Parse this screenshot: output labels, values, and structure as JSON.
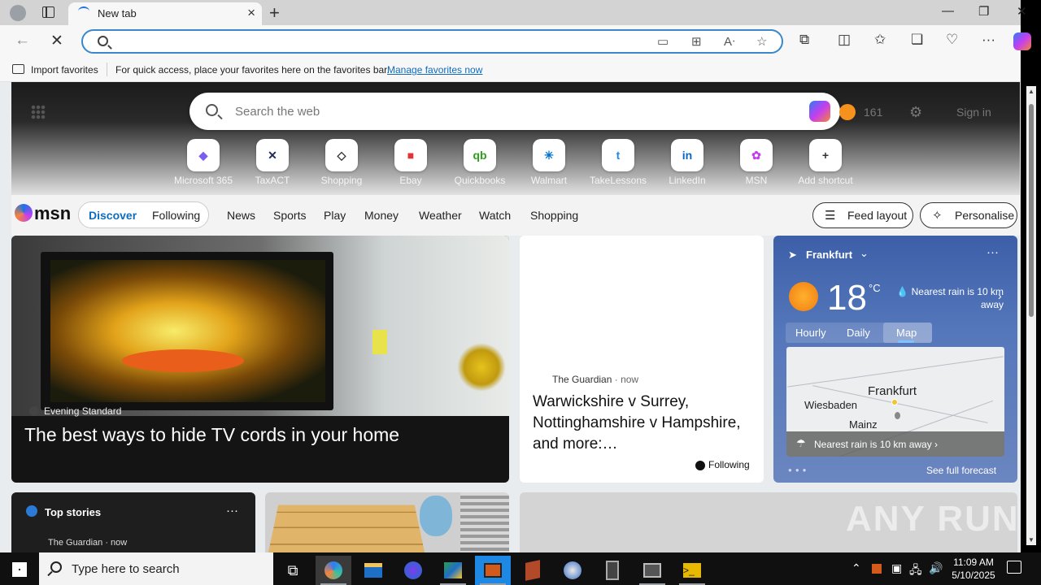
{
  "browser": {
    "tab_title": "New tab",
    "tab_close": "×",
    "new_tab": "+",
    "window_controls": [
      "—",
      "❐",
      "✕"
    ]
  },
  "favorites_bar": {
    "import_label": "Import favorites",
    "message": "For quick access, place your favorites here on the favorites bar.",
    "manage_link": "Manage favorites now"
  },
  "ntp": {
    "search_placeholder": "Search the web",
    "reward_points": "161",
    "sign_in": "Sign in",
    "shortcuts": [
      {
        "label": "Microsoft 365",
        "glyph": "◆",
        "color": "#7b5cf0"
      },
      {
        "label": "TaxACT",
        "glyph": "✕",
        "color": "#1d2b5c"
      },
      {
        "label": "Shopping",
        "glyph": "◇",
        "color": "#333333"
      },
      {
        "label": "Ebay",
        "glyph": "■",
        "color": "#e53238"
      },
      {
        "label": "Quickbooks",
        "glyph": "qb",
        "color": "#2ca01c"
      },
      {
        "label": "Walmart",
        "glyph": "✳",
        "color": "#0071ce"
      },
      {
        "label": "TakeLessons",
        "glyph": "t",
        "color": "#1e88e5"
      },
      {
        "label": "LinkedIn",
        "glyph": "in",
        "color": "#0a66c2"
      },
      {
        "label": "MSN",
        "glyph": "✿",
        "color": "#c43ef0"
      },
      {
        "label": "Add shortcut",
        "glyph": "+",
        "color": "#333333"
      }
    ]
  },
  "msn": {
    "logo_text": "msn",
    "discover": "Discover",
    "following": "Following",
    "nav": [
      "News",
      "Sports",
      "Play",
      "Money",
      "Weather",
      "Watch",
      "Shopping"
    ],
    "feed_layout": "Feed layout",
    "personalise": "Personalise"
  },
  "cards": {
    "main": {
      "source": "Evening Standard",
      "title": "The best ways to hide TV cords in your home"
    },
    "mid": {
      "source": "The Guardian",
      "time": "· now",
      "headline": "Warwickshire v Surrey, Nottinghamshire v Hampshire, and more:…",
      "follow": "Following"
    },
    "weather": {
      "location": "Frankfurt",
      "more": "···",
      "temp": "18",
      "unit": "°C",
      "rain": "Nearest rain is 10 km away",
      "tabs": [
        "Hourly",
        "Daily",
        "Map"
      ],
      "map_cities": [
        "Frankfurt",
        "Wiesbaden",
        "Mainz"
      ],
      "map_overlay": "Nearest rain is 10 km away ›",
      "see_forecast": "See full forecast"
    },
    "top_stories": {
      "title": "Top stories",
      "more": "···",
      "source": "The Guardian · now"
    }
  },
  "watermark": "ANY RUN",
  "taskbar": {
    "search_text": "Type here to search",
    "time": "11:09 AM",
    "date": "5/10/2025"
  }
}
